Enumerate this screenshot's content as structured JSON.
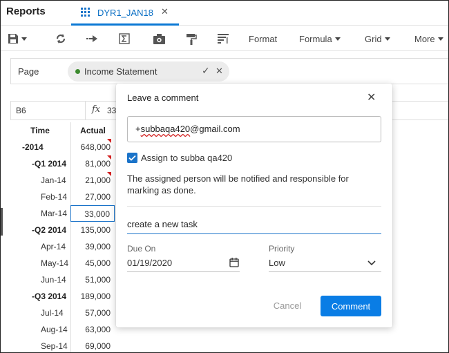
{
  "app": {
    "title": "Reports"
  },
  "tab": {
    "label": "DYR1_JAN18",
    "close_glyph": "✕",
    "icon": "grid-icon"
  },
  "toolbar": {
    "icons": [
      "save-icon",
      "refresh-icon",
      "forward-icon",
      "sigma-icon",
      "camera-icon",
      "paint-roller-icon",
      "sort-icon"
    ],
    "format_label": "Format",
    "formula_label": "Formula",
    "grid_label": "Grid",
    "more_label": "More"
  },
  "pov": {
    "label": "Page",
    "chip_value": "Income Statement",
    "dot_color": "#3c8a2e",
    "check_glyph": "✓",
    "close_glyph": "✕"
  },
  "formula_bar": {
    "cell_ref": "B6",
    "fx": "fx",
    "value": "33"
  },
  "grid": {
    "headers": {
      "time": "Time",
      "actual": "Actual"
    },
    "rows": [
      {
        "label": "-2014",
        "value": "648,000"
      },
      {
        "label": "-Q1 2014",
        "value": "81,000"
      },
      {
        "label": "Jan-14",
        "value": "21,000"
      },
      {
        "label": "Feb-14",
        "value": "27,000"
      },
      {
        "label": "Mar-14",
        "value": "33,000"
      },
      {
        "label": "-Q2 2014",
        "value": "135,000"
      },
      {
        "label": "Apr-14",
        "value": "39,000"
      },
      {
        "label": "May-14",
        "value": "45,000"
      },
      {
        "label": "Jun-14",
        "value": "51,000"
      },
      {
        "label": "-Q3 2014",
        "value": "189,000"
      },
      {
        "label": "Jul-14",
        "value": "57,000"
      },
      {
        "label": "Aug-14",
        "value": "63,000"
      },
      {
        "label": "Sep-14",
        "value": "69,000"
      }
    ]
  },
  "dialog": {
    "title": "Leave a comment",
    "close_glyph": "✕",
    "mention_prefix": "+",
    "mention_name": "subbaqa420",
    "mention_suffix": "@gmail.com",
    "assign_label": "Assign to subba qa420",
    "assign_checked": true,
    "note": "The assigned person will be notified and responsible for marking as done.",
    "task_text": "create a new task",
    "due_label": "Due On",
    "due_value": "01/19/2020",
    "priority_label": "Priority",
    "priority_value": "Low",
    "cancel_label": "Cancel",
    "comment_label": "Comment",
    "accent_color": "#0a7de5"
  }
}
